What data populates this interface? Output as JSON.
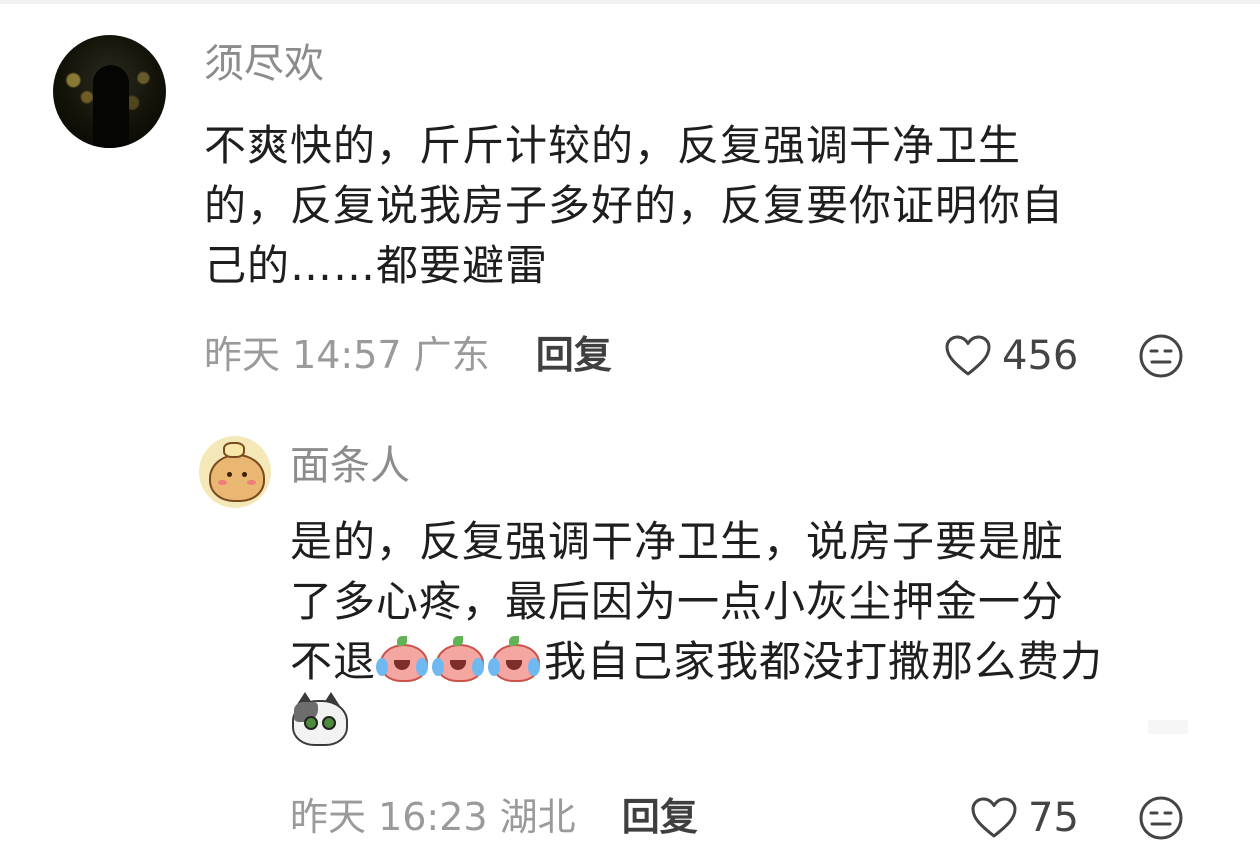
{
  "comments": [
    {
      "username": "须尽欢",
      "lines": [
        "不爽快的，斤斤计较的，反复强调干净卫生",
        "的，反复说我房子多好的，反复要你证明你自",
        "己的……都要避雷"
      ],
      "time_location": "昨天 14:57 广东",
      "reply_label": "回复",
      "likes": "456"
    },
    {
      "username": "面条人",
      "lines": [
        "是的，反复强调干净卫生，说房子要是脏",
        "了多心疼，最后因为一点小灰尘押金一分"
      ],
      "line3_prefix": "不退",
      "line3_suffix": "我自己家我都没打撒那么费力",
      "emoji_names": [
        "crying-peach-emoji",
        "crying-peach-emoji",
        "crying-peach-emoji",
        "cat-emoji"
      ],
      "time_location": "昨天 16:23 湖北",
      "reply_label": "回复",
      "likes": "75"
    }
  ],
  "icons": {
    "like": "heart-outline-icon",
    "react": "neutral-face-icon"
  },
  "colors": {
    "username": "#8c8c8c",
    "body_text": "#1e1e1e",
    "meta": "#9a9a9a",
    "reply": "#3f3f3f"
  }
}
